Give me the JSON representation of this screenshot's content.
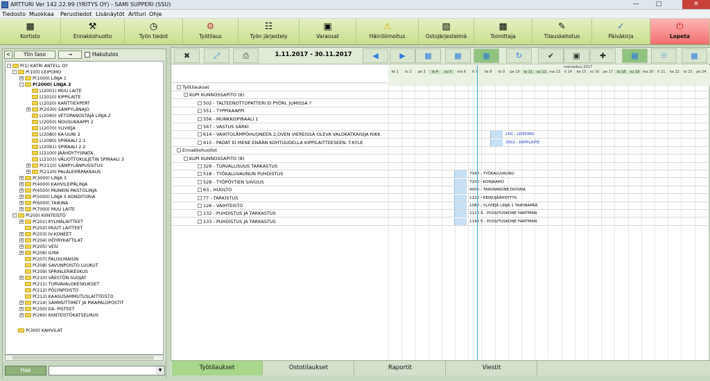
{
  "window": {
    "title": "ARTTURI Ver 142.22.99 (YRITYS OY) - SAMI SUPPERI (SSU)"
  },
  "menu": [
    "Tiedosto",
    "Muokkaa",
    "Perustiedot",
    "Lisänäytöt",
    "Artturi",
    "Ohje"
  ],
  "toolbar": [
    {
      "label": "Kortisto",
      "icon": "cabinet-icon"
    },
    {
      "label": "Ennakkohuolto",
      "icon": "tools-icon"
    },
    {
      "label": "Työn tiedot",
      "icon": "clock-icon"
    },
    {
      "label": "Työtilaus",
      "icon": "wrench-icon"
    },
    {
      "label": "Työn järjestely",
      "icon": "schedule-icon"
    },
    {
      "label": "Varaosat",
      "icon": "parts-icon"
    },
    {
      "label": "Häiriöilmoitus",
      "icon": "warning-icon"
    },
    {
      "label": "Ostojärjestelmä",
      "icon": "purchase-icon"
    },
    {
      "label": "Toimittaja",
      "icon": "supplier-icon"
    },
    {
      "label": "Tilauskehotus",
      "icon": "order-icon"
    },
    {
      "label": "Päiväkirja",
      "icon": "diary-icon"
    },
    {
      "label": "Lopeta",
      "icon": "power-icon"
    }
  ],
  "leftnav": {
    "back": "<",
    "up": "Ylin taso",
    "forward": "→",
    "filter_label": "Hakutulos"
  },
  "tree": [
    "P(1) KATRI ANTELL OY",
    "P(100) LEIPOMO",
    "P(1000) LINJA 1",
    "P(2000) LINJA 2",
    "L(2001) MUU LAITE",
    "L(2010) KIPPILAITE",
    "L(2020) KANTTIEXPERT",
    "P(2030) SÄMPYLÄNAJO",
    "L(2040) VETOPANOSTAJA LINJA 2",
    "L(2050) NOUSUKAAPPI 2",
    "L(2070) YLIVIEJA",
    "L(2080) KA-UUNI 2",
    "L(2090) SPIRAALI 2.1",
    "L(2091) SPIRAALI 2.2",
    "L(2100) JÄÄHDYTYSRATA",
    "L(2103) VÄLIOTTOKULJETIN SPIRAALI 3",
    "P(2110) SÄMPYLÄNPUSSITUS",
    "P(2120) PALALEIPÄPAKKAUS",
    "P(3000) LINJA 3",
    "P(4000) KAHVILEIPÄLINJA",
    "P(4500) MUNKIN PAISTOLINJA",
    "P(5000) LINJA 5 KONDITORIA",
    "P(6000) TAIKINA",
    "P(7000) MUU LAITE",
    "P(200) KIINTEISTÖ",
    "P(201) KYLMÄLAITTEET",
    "P(202) MUUT LAITTEET",
    "P(203) IV-KONEET",
    "P(204) HÖYRYKATTILAT",
    "P(205) VESI",
    "P(206) ILMA",
    "P(207) PALOILMAISIN",
    "P(208) SAVUNPOISTO LUUKUT",
    "P(209) SPRINLERIKESKUS",
    "P(210) VÄESTÖN SUOJAT",
    "P(211) TURVAVALOKESKUKSET",
    "P(212) PÖLYNPOISTO",
    "P(213) KAASUSAMMUTUSLAITTEISTO",
    "P(214) SAMMUTTIMET JA PIKAPALOPOSTIT",
    "P(250) EA- PISTEET",
    "P(260) KIINTEISTÖKATSELMUS",
    "P(300) KAHVILAT"
  ],
  "search": {
    "button": "Hae",
    "select_value": ""
  },
  "schedule": {
    "date_range": "1.11.2017 - 30.11.2017",
    "month_label": "marraskuu 2017",
    "days": [
      "ke 1",
      "to 2",
      "pe 3",
      "la 4",
      "su 5",
      "ma 6",
      "ti 7",
      "ke 8",
      "to 9",
      "pe 10",
      "la 11",
      "su 12",
      "ma 13",
      "ti 14",
      "ke 15",
      "to 16",
      "pe 17",
      "la 18",
      "su 19",
      "ma 20",
      "ti 21",
      "ke 22",
      "to 23",
      "pe 24"
    ],
    "weekend_days": [
      3,
      4,
      10,
      11,
      17,
      18
    ]
  },
  "rows": [
    {
      "text": "Työtilaukset",
      "level": 0
    },
    {
      "text": "KUPI KUNNOSSAPITO (6)",
      "level": 1
    },
    {
      "text": "502 - TALTEENOTTOPATTERI EI PYÖRI, JUMISSA ?",
      "level": 2
    },
    {
      "text": "551 - TYPPIKAAPPI",
      "level": 2
    },
    {
      "text": "556 - MUNKKISPIRAALI 1",
      "level": 2
    },
    {
      "text": "567 - VASTUS SÄRKI",
      "level": 2
    },
    {
      "text": "614 - VAIHTOLÄMPÖHUONEEN 2,OVEN VIEREISSÄ OLEVA VALOKATKAISIJA RIKK",
      "level": 2,
      "bar": "100 - LEIPOMO",
      "bar_color": "blue"
    },
    {
      "text": "615 - PADAT EI MENE ENÄÄN KOHTUUDELLA KIPPILAITTEESEEN. T.KYLE",
      "level": 2,
      "bar": "3002 - KIPPILAITE",
      "bar_color": "blue"
    },
    {
      "text": "Ennakkohuollot",
      "level": 0
    },
    {
      "text": "KUPI KUNNOSSAPITO (8)",
      "level": 1
    },
    {
      "text": "329 - TURVALLISUUS TARKASTUS",
      "level": 2
    },
    {
      "text": "518 - TYÖKALUVAUNUN PUHDISTUS",
      "level": 2,
      "bar": "7040 - TYÖKALUVAUNU"
    },
    {
      "text": "528 - TYÖPÖYTIEN SIIVOUS",
      "level": 2,
      "bar": "7200 - KORJAAMO"
    },
    {
      "text": "63 - HUOLTO",
      "level": 2,
      "bar": "4005 - TAIKINAKONE DIOSNA"
    },
    {
      "text": "77 - TARKISTUS",
      "level": 2,
      "bar": "1120 - KEINUJÄÄHDYTYS"
    },
    {
      "text": "126 - VAIHTEISTO",
      "level": 2,
      "bar": "1080 - YLIVIEJÄ LINJA 1 TAIKINAPÄÄ"
    },
    {
      "text": "132 - PUHDISTUS JA TARKASTUS",
      "level": 2,
      "bar": "2120 4 - PUSSITUSKONE HARTMAN"
    },
    {
      "text": "133 - PUHDISTUS JA TARKASTUS",
      "level": 2,
      "bar": "1142 5 - PUSSITUSKONE HARTMAN"
    }
  ],
  "tabs": [
    "Työtilaukset",
    "Ostotilaukset",
    "Raportit",
    "Viestit"
  ],
  "colors": {
    "toolbar": "#c8de8e",
    "accent_tab": "#a8d68a",
    "today_line": "#30a8d8",
    "lopeta": "#f07070"
  }
}
